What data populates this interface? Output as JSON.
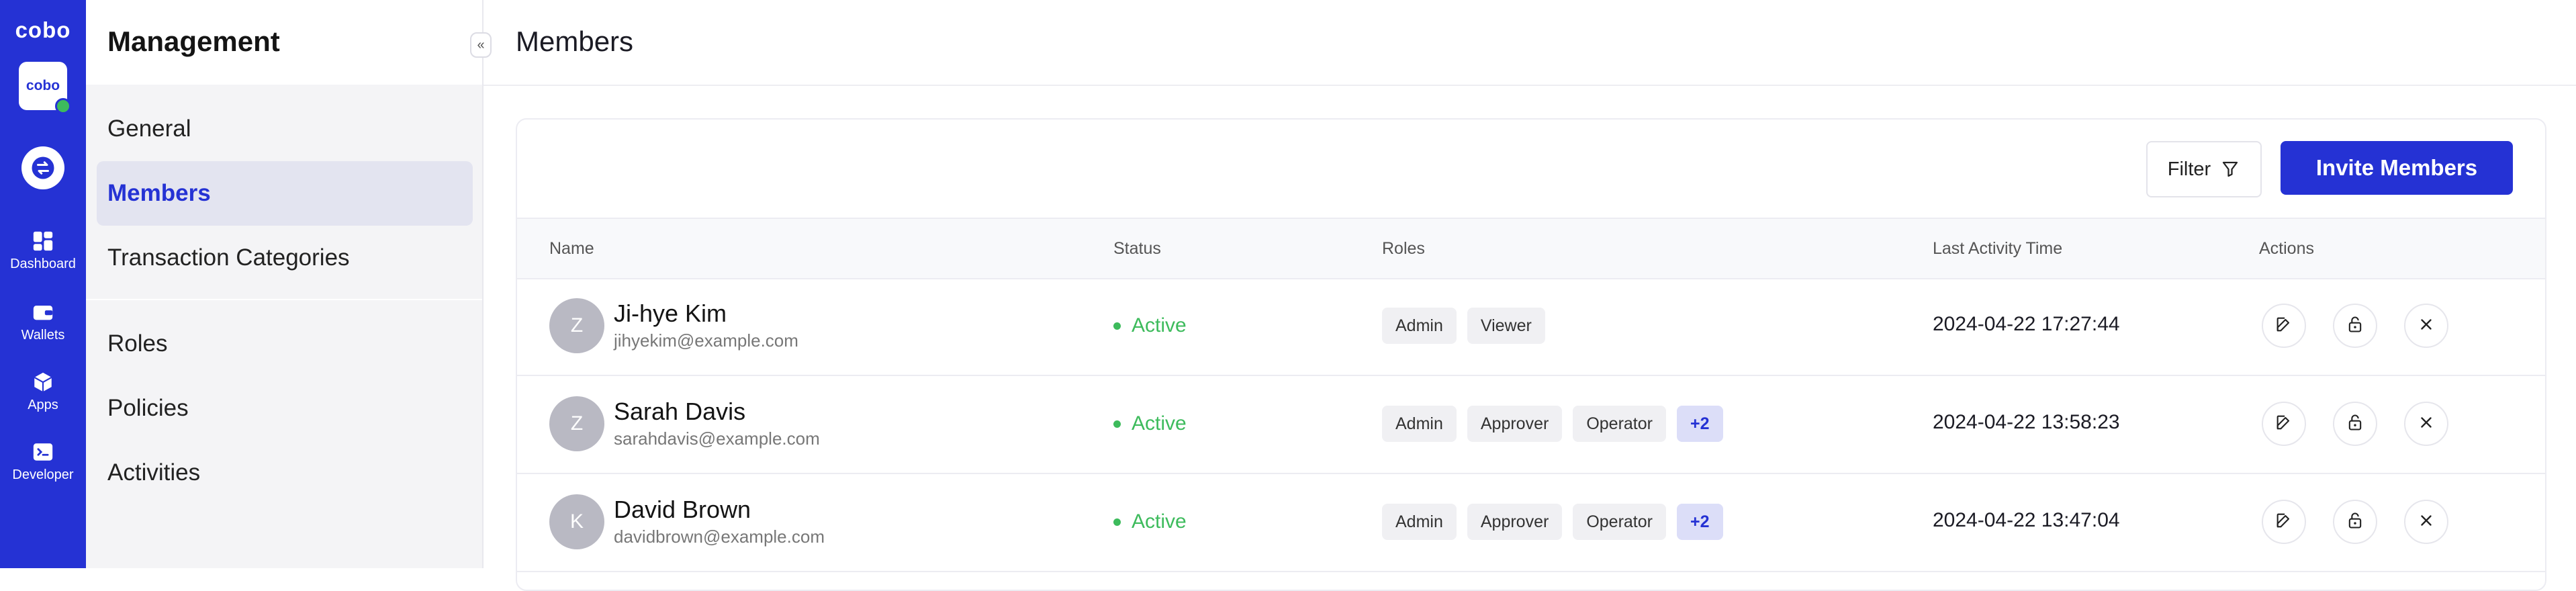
{
  "brand": {
    "logo_text": "cobo",
    "app_tile_text": "cobo"
  },
  "rail": {
    "items": [
      {
        "label": "Dashboard",
        "icon": "dashboard-icon"
      },
      {
        "label": "Wallets",
        "icon": "wallet-icon"
      },
      {
        "label": "Apps",
        "icon": "apps-icon"
      },
      {
        "label": "Developer",
        "icon": "developer-icon"
      }
    ]
  },
  "sidebar": {
    "title": "Management",
    "collapse_glyph": "«",
    "items": [
      {
        "label": "General"
      },
      {
        "label": "Members",
        "active": true
      },
      {
        "label": "Transaction Categories"
      },
      {
        "label": "Roles"
      },
      {
        "label": "Policies"
      },
      {
        "label": "Activities"
      }
    ]
  },
  "main": {
    "page_title": "Members",
    "filter_label": "Filter",
    "invite_label": "Invite Members",
    "columns": [
      "Name",
      "Status",
      "Roles",
      "Last Activity Time",
      "Actions"
    ],
    "rows": [
      {
        "initial": "Z",
        "name": "Ji-hye Kim",
        "email": "jihyekim@example.com",
        "status": "Active",
        "roles": [
          "Admin",
          "Viewer"
        ],
        "more": "",
        "time": "2024-04-22 17:27:44"
      },
      {
        "initial": "Z",
        "name": "Sarah Davis",
        "email": "sarahdavis@example.com",
        "status": "Active",
        "roles": [
          "Admin",
          "Approver",
          "Operator"
        ],
        "more": "+2",
        "time": "2024-04-22 13:58:23"
      },
      {
        "initial": "K",
        "name": "David Brown",
        "email": "davidbrown@example.com",
        "status": "Active",
        "roles": [
          "Admin",
          "Approver",
          "Operator"
        ],
        "more": "+2",
        "time": "2024-04-22 13:47:04"
      }
    ]
  },
  "colors": {
    "brand": "#2532d4",
    "active_status": "#3dbb5c",
    "avatar": "#b9b9c3"
  }
}
